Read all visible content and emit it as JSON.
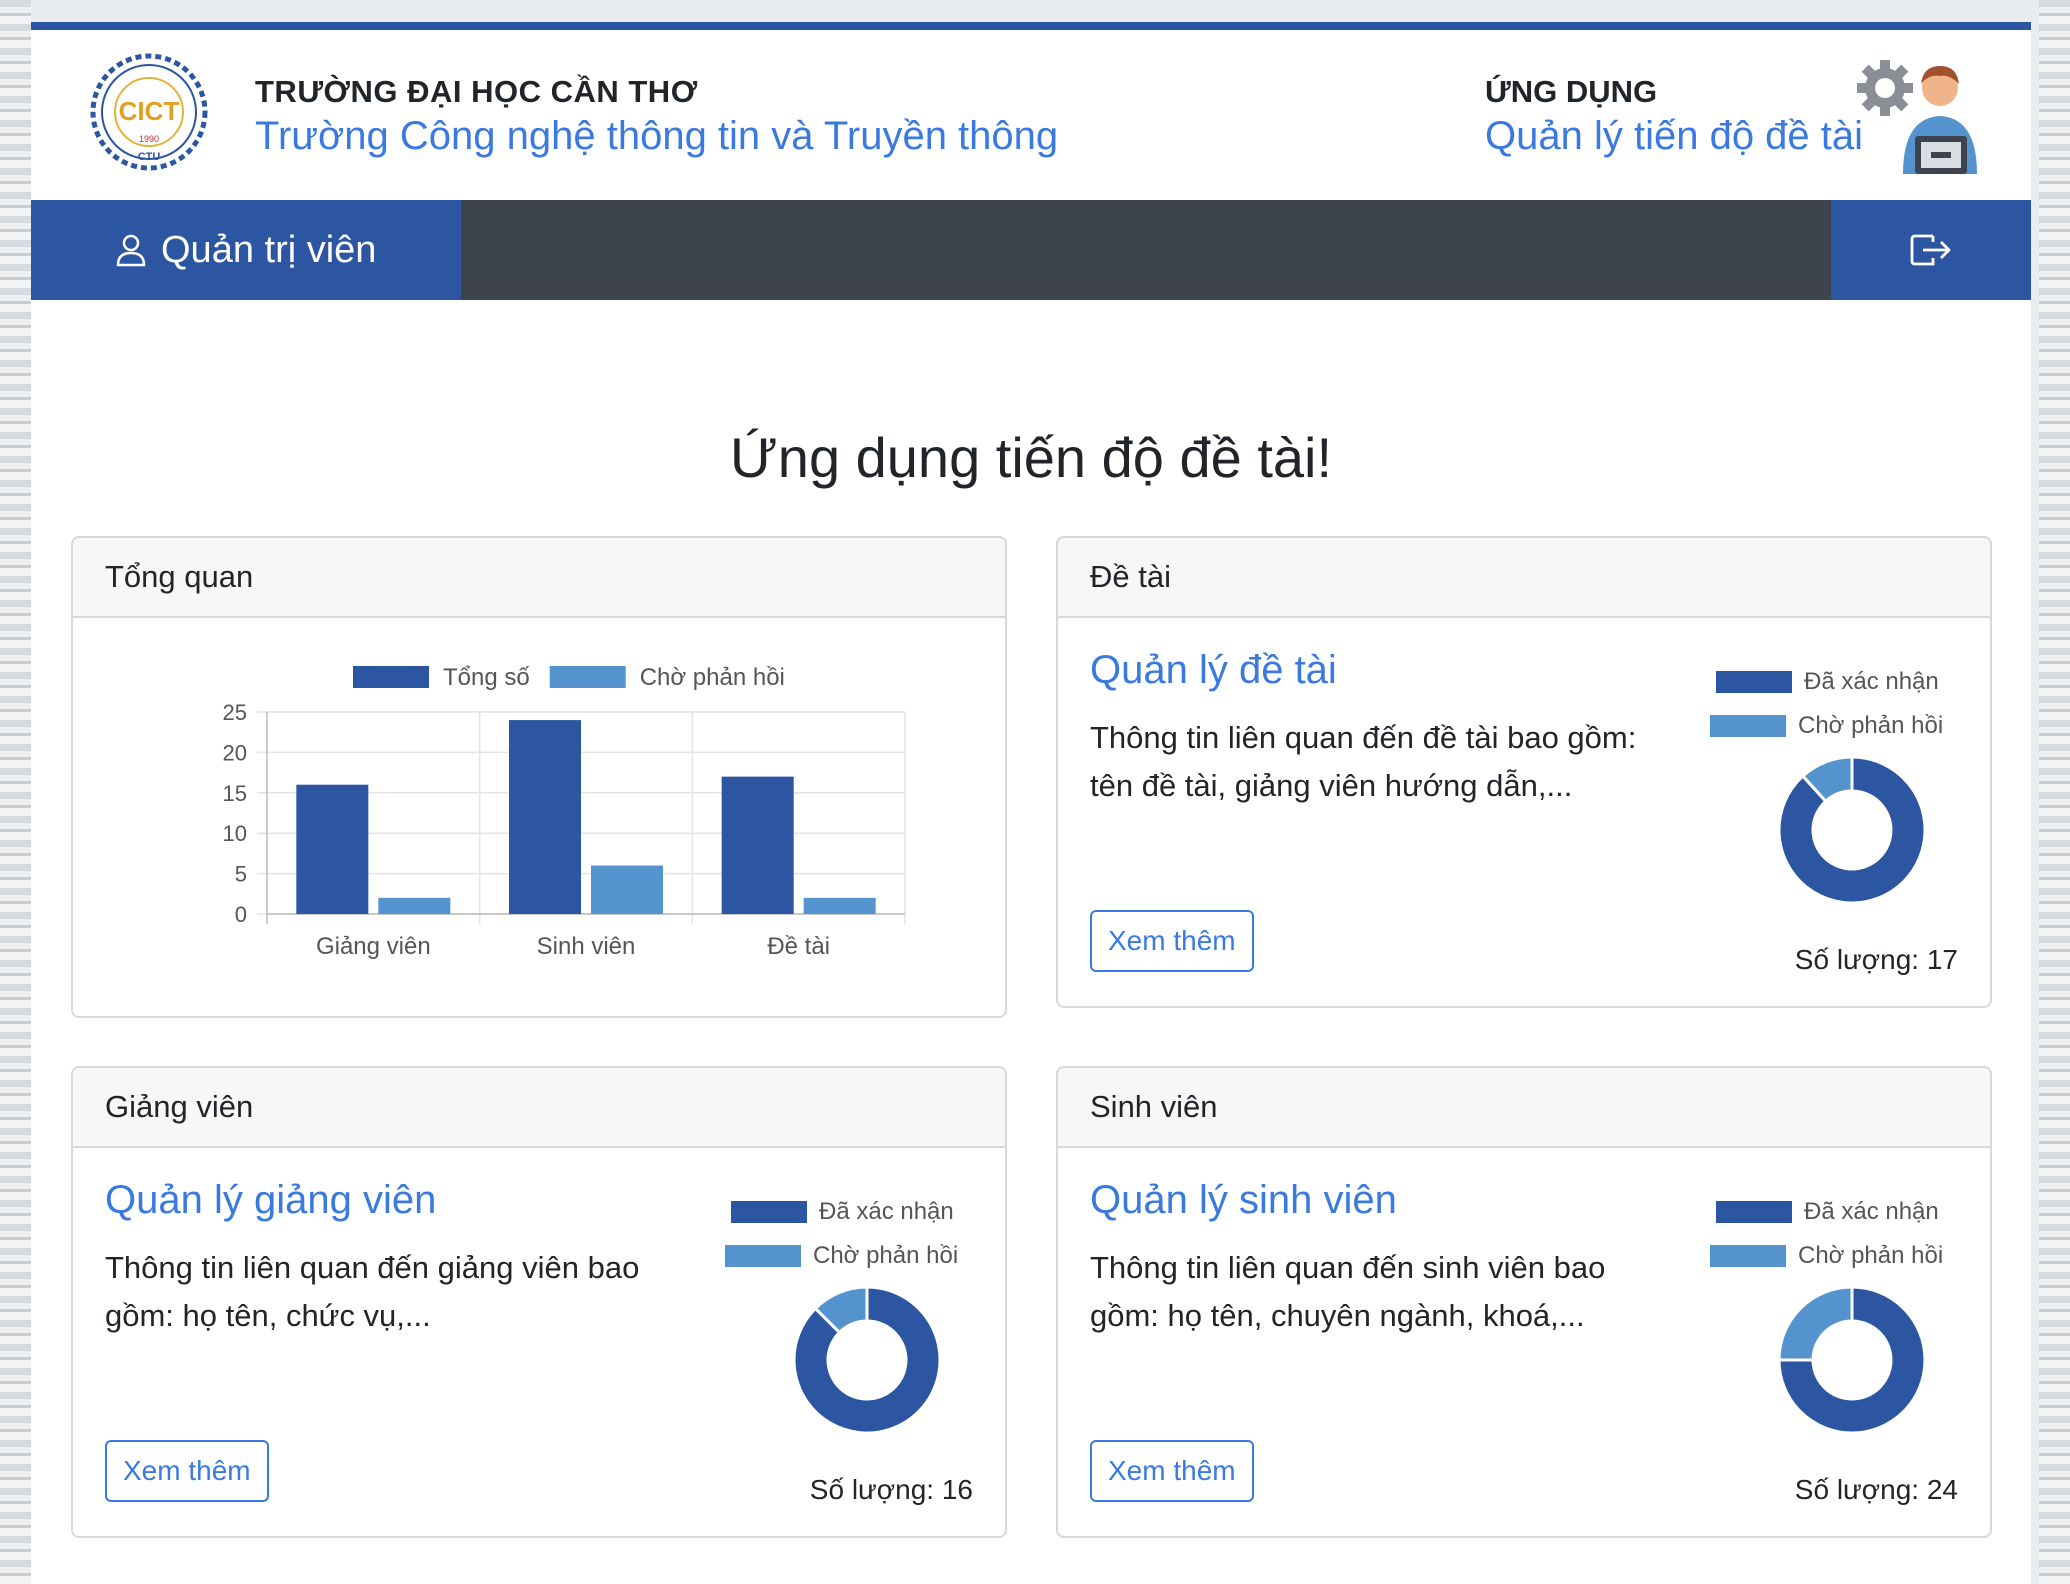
{
  "header": {
    "school_top": "TRƯỜNG ĐẠI HỌC CẦN THƠ",
    "school_name": "Trường Công nghệ thông tin và Truyền thông",
    "app_top": "ỨNG DỤNG",
    "app_name": "Quản lý tiến độ đề tài",
    "logo": {
      "text": "CICT",
      "year": "1990",
      "sub": "CTU",
      "ring_text": "COLLEGE OF INFORMATION AND COMMUNICATION TECHNOLOGY"
    }
  },
  "nav": {
    "user_label": "Quản trị viên"
  },
  "main_title": "Ứng dụng tiến độ đề tài!",
  "colors": {
    "primary": "#2c55a2",
    "secondary": "#5593cf",
    "link": "#3a79e0",
    "navbar": "#3d444d"
  },
  "legend": {
    "confirmed": "Đã xác nhận",
    "pending": "Chờ phản hồi"
  },
  "overview": {
    "header": "Tổng quan",
    "chart_data": {
      "type": "bar",
      "categories": [
        "Giảng viên",
        "Sinh viên",
        "Đề tài"
      ],
      "series": [
        {
          "name": "Tổng số",
          "values": [
            16,
            24,
            17
          ],
          "color": "#2c55a2"
        },
        {
          "name": "Chờ phản hồi",
          "values": [
            2,
            6,
            2
          ],
          "color": "#5593cf"
        }
      ],
      "ylim": [
        0,
        25
      ],
      "yticks": [
        0,
        5,
        10,
        15,
        20,
        25
      ],
      "legend": "top",
      "grid": true
    }
  },
  "topics": {
    "header": "Đề tài",
    "title": "Quản lý đề tài",
    "text1": "Thông tin liên quan đến đề tài bao gồm:",
    "text2": "tên đề tài, giảng viên hướng dẫn,...",
    "button": "Xem thêm",
    "count": "Số lượng: 17",
    "chart_data": {
      "type": "pie",
      "labels": [
        "Đã xác nhận",
        "Chờ phản hồi"
      ],
      "values": [
        15,
        2
      ]
    }
  },
  "lecturers": {
    "header": "Giảng viên",
    "title": "Quản lý giảng viên",
    "text1": "Thông tin liên quan đến giảng viên bao",
    "text2": "gồm: họ tên, chức vụ,...",
    "button": "Xem thêm",
    "count": "Số lượng: 16",
    "chart_data": {
      "type": "pie",
      "labels": [
        "Đã xác nhận",
        "Chờ phản hồi"
      ],
      "values": [
        14,
        2
      ]
    }
  },
  "students": {
    "header": "Sinh viên",
    "title": "Quản lý sinh viên",
    "text1": "Thông tin liên quan đến sinh viên bao",
    "text2": "gồm: họ tên, chuyên ngành, khoá,...",
    "button": "Xem thêm",
    "count": "Số lượng: 24",
    "chart_data": {
      "type": "pie",
      "labels": [
        "Đã xác nhận",
        "Chờ phản hồi"
      ],
      "values": [
        18,
        6
      ]
    }
  }
}
